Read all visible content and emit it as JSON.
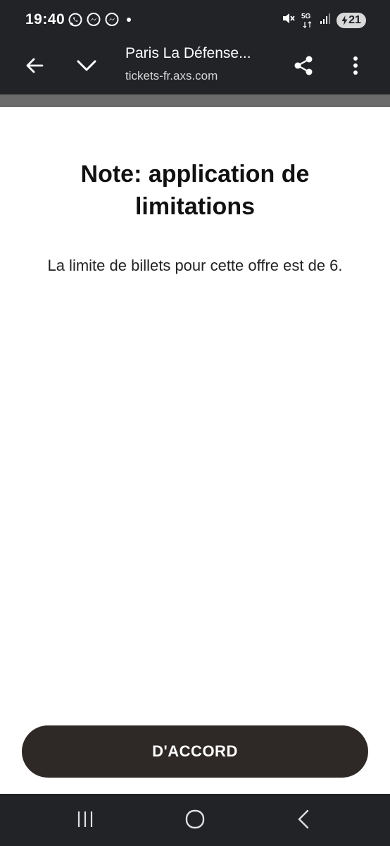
{
  "status_bar": {
    "time": "19:40",
    "network_label": "5G",
    "battery_level": "21",
    "left_icons": [
      "whatsapp-icon",
      "messenger-icon",
      "messenger-icon",
      "dot-icon"
    ],
    "right_icons": [
      "mute-icon",
      "network-5g-icon",
      "signal-icon",
      "battery-icon"
    ]
  },
  "toolbar": {
    "page_title": "Paris La Défense...",
    "url": "tickets-fr.axs.com",
    "icons": [
      "back-arrow-icon",
      "chevron-down-icon",
      "share-icon",
      "more-vert-icon"
    ]
  },
  "dialog": {
    "heading": "Note: application de limitations",
    "message": "La limite de billets pour cette offre est de 6.",
    "ok_label": "D'ACCORD"
  },
  "nav_bar": {
    "icons": [
      "recent-apps-icon",
      "home-icon",
      "back-icon"
    ]
  },
  "colors": {
    "system_bar": "#212327",
    "button": "#2e2826",
    "progress_strip": "#6b6b6b"
  }
}
